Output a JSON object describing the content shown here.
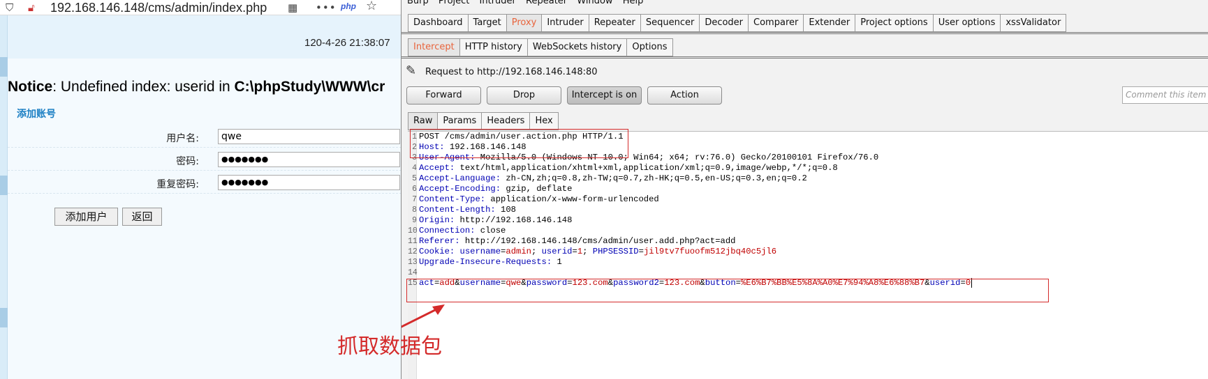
{
  "browser": {
    "url": "192.168.146.148/cms/admin/index.php",
    "php_badge": "php",
    "datetime": "120-4-26 21:38:07",
    "notice_label": "Notice",
    "notice_text": ": Undefined index: userid in ",
    "notice_path": "C:\\phpStudy\\WWW\\cr",
    "form_title": "添加账号",
    "fields": [
      {
        "label": "用户名:",
        "value": "qwe"
      },
      {
        "label": "密码:",
        "value": "●●●●●●●"
      },
      {
        "label": "重复密码:",
        "value": "●●●●●●●"
      }
    ],
    "buttons": {
      "add": "添加用户",
      "back": "返回"
    }
  },
  "burp": {
    "menu": [
      "Burp",
      "Project",
      "Intruder",
      "Repeater",
      "Window",
      "Help"
    ],
    "main_tabs": [
      "Dashboard",
      "Target",
      "Proxy",
      "Intruder",
      "Repeater",
      "Sequencer",
      "Decoder",
      "Comparer",
      "Extender",
      "Project options",
      "User options",
      "xssValidator"
    ],
    "proxy_tabs": [
      "Intercept",
      "HTTP history",
      "WebSockets history",
      "Options"
    ],
    "request_to": "Request to http://192.168.146.148:80",
    "actions": {
      "forward": "Forward",
      "drop": "Drop",
      "intercept": "Intercept is on",
      "action": "Action"
    },
    "comment_placeholder": "Comment this item",
    "editor_tabs": [
      "Raw",
      "Params",
      "Headers",
      "Hex"
    ],
    "line_numbers": [
      "1",
      "2",
      "3",
      "4",
      "5",
      "6",
      "7",
      "8",
      "9",
      "10",
      "11",
      "12",
      "13",
      "14",
      "15"
    ],
    "raw": {
      "l1": "POST /cms/admin/user.action.php HTTP/1.1",
      "l2k": "Host:",
      "l2v": " 192.168.146.148",
      "l3k": "User-Agent:",
      "l3v": " Mozilla/5.0 (Windows NT 10.0; Win64; x64; rv:76.0) Gecko/20100101 Firefox/76.0",
      "l4k": "Accept:",
      "l4v": " text/html,application/xhtml+xml,application/xml;q=0.9,image/webp,*/*;q=0.8",
      "l5k": "Accept-Language:",
      "l5v": " zh-CN,zh;q=0.8,zh-TW;q=0.7,zh-HK;q=0.5,en-US;q=0.3,en;q=0.2",
      "l6k": "Accept-Encoding:",
      "l6v": " gzip, deflate",
      "l7k": "Content-Type:",
      "l7v": " application/x-www-form-urlencoded",
      "l8k": "Content-Length:",
      "l8v": " 108",
      "l9k": "Origin:",
      "l9v": " http://192.168.146.148",
      "l10k": "Connection:",
      "l10v": " close",
      "l11k": "Referer:",
      "l11v": " http://192.168.146.148/cms/admin/user.add.php?act=add",
      "l12k": "Cookie:",
      "l12a": "username",
      "l12b": "admin",
      "l12c": "userid",
      "l12d": "1",
      "l12e": "PHPSESSID",
      "l12f": "jil9tv7fuoofm512jbq40c5jl6",
      "l13k": "Upgrade-Insecure-Requests:",
      "l13v": " 1",
      "b1": "act",
      "b2": "add",
      "b3": "username",
      "b4": "qwe",
      "b5": "password",
      "b6": "123.com",
      "b7": "password2",
      "b8": "123.com",
      "b9": "button",
      "b10": "%E6%B7%BB%E5%8A%A0%E7%94%A8%E6%88%B7",
      "b11": "userid",
      "b12": "0"
    },
    "caption": "抓取数据包"
  }
}
